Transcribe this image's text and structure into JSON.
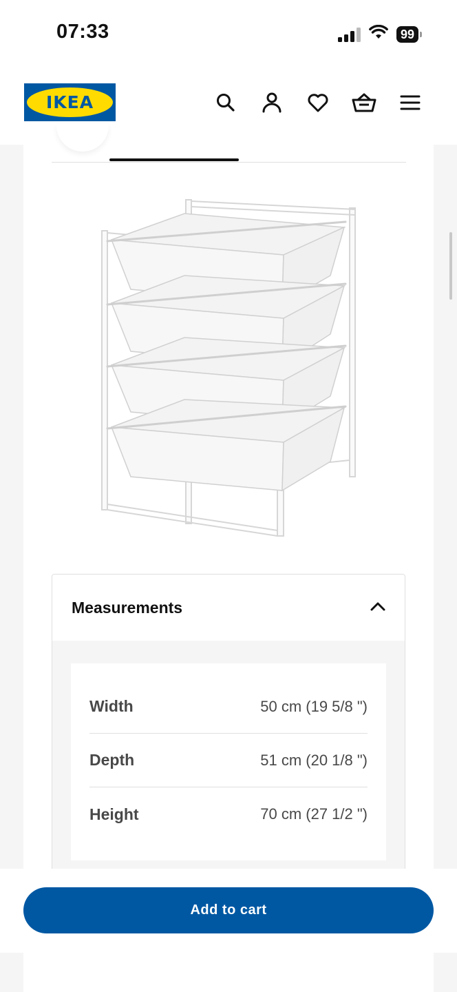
{
  "status_bar": {
    "time": "07:33",
    "battery": "99",
    "icons": [
      "signal-icon",
      "wifi-icon",
      "battery-icon"
    ]
  },
  "header": {
    "logo_text": "IKEA",
    "icons": [
      "search-icon",
      "account-icon",
      "heart-icon",
      "basket-icon",
      "menu-icon"
    ]
  },
  "product": {
    "image_alt": "white wire basket drawer frame"
  },
  "measurements": {
    "title": "Measurements",
    "rows": [
      {
        "label": "Width",
        "value": "50 cm (19 5/8 \")"
      },
      {
        "label": "Depth",
        "value": "51 cm (20 1/8 \")"
      },
      {
        "label": "Height",
        "value": "70 cm (27 1/2 \")"
      }
    ]
  },
  "cart": {
    "button_label": "Add to cart"
  },
  "colors": {
    "ikea_blue": "#0058a3",
    "ikea_yellow": "#ffdb00",
    "background": "#f5f5f5"
  }
}
